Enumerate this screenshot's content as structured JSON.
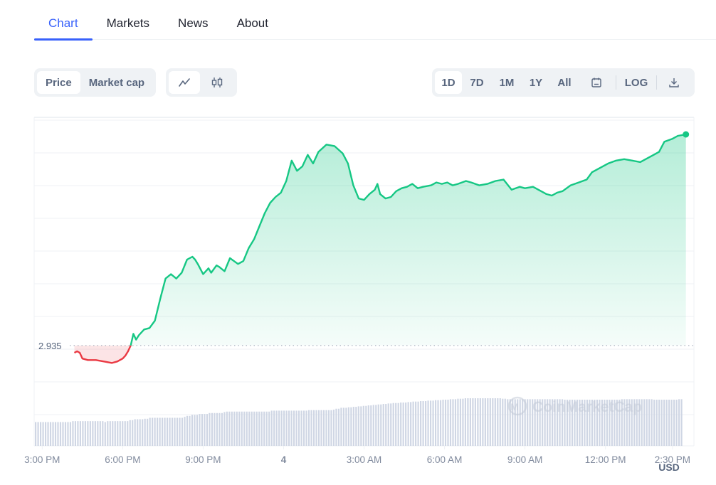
{
  "tabs": [
    {
      "label": "Chart",
      "active": true
    },
    {
      "label": "Markets",
      "active": false
    },
    {
      "label": "News",
      "active": false
    },
    {
      "label": "About",
      "active": false
    }
  ],
  "metric_toggle": [
    {
      "label": "Price",
      "active": true
    },
    {
      "label": "Market cap",
      "active": false
    }
  ],
  "chart_type_toggle": [
    {
      "icon": "line-chart-icon",
      "active": true
    },
    {
      "icon": "candlestick-icon",
      "active": false
    }
  ],
  "range_toggle": [
    {
      "label": "1D",
      "active": true
    },
    {
      "label": "7D",
      "active": false
    },
    {
      "label": "1M",
      "active": false
    },
    {
      "label": "1Y",
      "active": false
    },
    {
      "label": "All",
      "active": false
    }
  ],
  "tools": {
    "calendar_icon": "calendar-icon",
    "log_label": "LOG",
    "download_icon": "download-icon"
  },
  "colors": {
    "accent": "#3861fb",
    "up": "#16c784",
    "down": "#ea3943",
    "volume": "#cfd6e4",
    "grid": "#eff2f5",
    "axis_text": "#808a9d"
  },
  "watermark": "CoinMarketCap",
  "chart_data": {
    "type": "line",
    "title": "",
    "xlabel": "",
    "ylabel": "",
    "currency_label": "USD",
    "reference_price": 2.935,
    "reference_label": "2.935",
    "x_ticks": [
      "3:00 PM",
      "6:00 PM",
      "9:00 PM",
      "4",
      "3:00 AM",
      "6:00 AM",
      "9:00 AM",
      "12:00 PM",
      "2:30 PM"
    ],
    "x_tick_hours": [
      0,
      3,
      6,
      9,
      12,
      15,
      18,
      21,
      23.5
    ],
    "x_range_hours": [
      -0.3,
      24.3
    ],
    "y_range": [
      2.91,
      3.08
    ],
    "grid": true,
    "series": [
      {
        "name": "Price",
        "hours": [
          1.2,
          1.3,
          1.4,
          1.5,
          1.7,
          2.0,
          2.3,
          2.6,
          2.8,
          3.0,
          3.1,
          3.2,
          3.3,
          3.4,
          3.5,
          3.6,
          3.8,
          4.0,
          4.2,
          4.4,
          4.6,
          4.8,
          5.0,
          5.2,
          5.4,
          5.6,
          5.7,
          5.8,
          6.0,
          6.2,
          6.3,
          6.5,
          6.6,
          6.8,
          7.0,
          7.3,
          7.5,
          7.7,
          7.9,
          8.1,
          8.3,
          8.5,
          8.7,
          8.9,
          9.1,
          9.3,
          9.5,
          9.7,
          9.9,
          10.1,
          10.3,
          10.6,
          10.9,
          11.2,
          11.4,
          11.6,
          11.8,
          12.0,
          12.2,
          12.4,
          12.5,
          12.6,
          12.8,
          13.0,
          13.2,
          13.4,
          13.6,
          13.8,
          14.0,
          14.2,
          14.5,
          14.7,
          14.9,
          15.1,
          15.3,
          15.5,
          15.8,
          16.0,
          16.3,
          16.6,
          16.9,
          17.2,
          17.5,
          17.8,
          18.0,
          18.3,
          18.6,
          18.8,
          19.0,
          19.2,
          19.4,
          19.7,
          20.0,
          20.3,
          20.5,
          20.8,
          21.1,
          21.4,
          21.7,
          22.0,
          22.3,
          22.6,
          22.8,
          23.0,
          23.2,
          23.5,
          23.7,
          24.0
        ],
        "values": [
          2.93,
          2.931,
          2.93,
          2.926,
          2.925,
          2.925,
          2.924,
          2.923,
          2.924,
          2.926,
          2.928,
          2.931,
          2.935,
          2.943,
          2.939,
          2.942,
          2.946,
          2.947,
          2.952,
          2.967,
          2.981,
          2.984,
          2.981,
          2.985,
          2.994,
          2.996,
          2.994,
          2.991,
          2.984,
          2.988,
          2.985,
          2.99,
          2.989,
          2.986,
          2.995,
          2.991,
          2.993,
          3.002,
          3.008,
          3.017,
          3.026,
          3.033,
          3.037,
          3.04,
          3.048,
          3.062,
          3.055,
          3.058,
          3.066,
          3.06,
          3.068,
          3.073,
          3.072,
          3.067,
          3.06,
          3.045,
          3.036,
          3.035,
          3.039,
          3.042,
          3.046,
          3.039,
          3.036,
          3.037,
          3.041,
          3.043,
          3.044,
          3.046,
          3.043,
          3.044,
          3.045,
          3.047,
          3.046,
          3.047,
          3.045,
          3.046,
          3.048,
          3.047,
          3.045,
          3.046,
          3.048,
          3.049,
          3.042,
          3.044,
          3.043,
          3.044,
          3.041,
          3.039,
          3.038,
          3.04,
          3.041,
          3.045,
          3.047,
          3.049,
          3.054,
          3.057,
          3.06,
          3.062,
          3.063,
          3.062,
          3.061,
          3.064,
          3.066,
          3.068,
          3.075,
          3.077,
          3.079,
          3.08
        ]
      },
      {
        "name": "Volume",
        "relative_values_note": "relative to max",
        "values": [
          0.5,
          0.5,
          0.5,
          0.5,
          0.5,
          0.5,
          0.5,
          0.5,
          0.5,
          0.5,
          0.5,
          0.5,
          0.5,
          0.5,
          0.5,
          0.52,
          0.52,
          0.52,
          0.52,
          0.52,
          0.52,
          0.52,
          0.52,
          0.52,
          0.52,
          0.52,
          0.52,
          0.52,
          0.5,
          0.52,
          0.52,
          0.52,
          0.52,
          0.52,
          0.52,
          0.52,
          0.52,
          0.52,
          0.54,
          0.54,
          0.56,
          0.56,
          0.56,
          0.56,
          0.57,
          0.57,
          0.59,
          0.59,
          0.59,
          0.59,
          0.59,
          0.59,
          0.59,
          0.59,
          0.59,
          0.59,
          0.59,
          0.59,
          0.59,
          0.59,
          0.61,
          0.63,
          0.63,
          0.65,
          0.65,
          0.65,
          0.67,
          0.67,
          0.67,
          0.67,
          0.69,
          0.69,
          0.69,
          0.69,
          0.69,
          0.69,
          0.71,
          0.72,
          0.72,
          0.72,
          0.72,
          0.72,
          0.72,
          0.72,
          0.72,
          0.72,
          0.72,
          0.72,
          0.72,
          0.72,
          0.72,
          0.72,
          0.72,
          0.72,
          0.72,
          0.74,
          0.74,
          0.74,
          0.74,
          0.74,
          0.74,
          0.74,
          0.74,
          0.74,
          0.74,
          0.74,
          0.74,
          0.74,
          0.74,
          0.74,
          0.75,
          0.75,
          0.75,
          0.75,
          0.75,
          0.75,
          0.75,
          0.75,
          0.75,
          0.75,
          0.76,
          0.78,
          0.78,
          0.8,
          0.8,
          0.8,
          0.81,
          0.81,
          0.82,
          0.82,
          0.83,
          0.83,
          0.84,
          0.84,
          0.85,
          0.85,
          0.86,
          0.86,
          0.87,
          0.87,
          0.88,
          0.88,
          0.89,
          0.89,
          0.9,
          0.9,
          0.9,
          0.91,
          0.91,
          0.91,
          0.92,
          0.92,
          0.93,
          0.93,
          0.93,
          0.94,
          0.94,
          0.94,
          0.95,
          0.95,
          0.95,
          0.96,
          0.96,
          0.96,
          0.97,
          0.97,
          0.97,
          0.98,
          0.98,
          0.98,
          0.99,
          0.99,
          0.99,
          1.0,
          1.0,
          1.0,
          1.0,
          1.0,
          1.0,
          1.0,
          1.0,
          1.0,
          1.0,
          1.0,
          1.0,
          1.0,
          1.0,
          1.0,
          0.99,
          0.99,
          0.98,
          0.98,
          0.98,
          0.98,
          0.98,
          0.98,
          0.98,
          0.98,
          0.98,
          0.98,
          0.98,
          0.98,
          0.98,
          0.98,
          0.98,
          0.98,
          0.98,
          0.98,
          0.98,
          0.98,
          0.98,
          0.98,
          0.98,
          0.97,
          0.97,
          0.97,
          0.97,
          0.97,
          0.97,
          0.97,
          0.97,
          0.97,
          0.97,
          0.97,
          0.97,
          0.97,
          0.97,
          0.97,
          0.97,
          0.97,
          0.97,
          0.97,
          0.97,
          0.97,
          0.97,
          0.97,
          0.98,
          0.98,
          0.98,
          0.98,
          0.98,
          0.98,
          0.98,
          0.98,
          0.98,
          0.98,
          0.98,
          0.98,
          0.98,
          0.97,
          0.97,
          0.97,
          0.97,
          0.97,
          0.97,
          0.97,
          0.97,
          0.97,
          0.97,
          0.98,
          0.98
        ]
      }
    ]
  }
}
